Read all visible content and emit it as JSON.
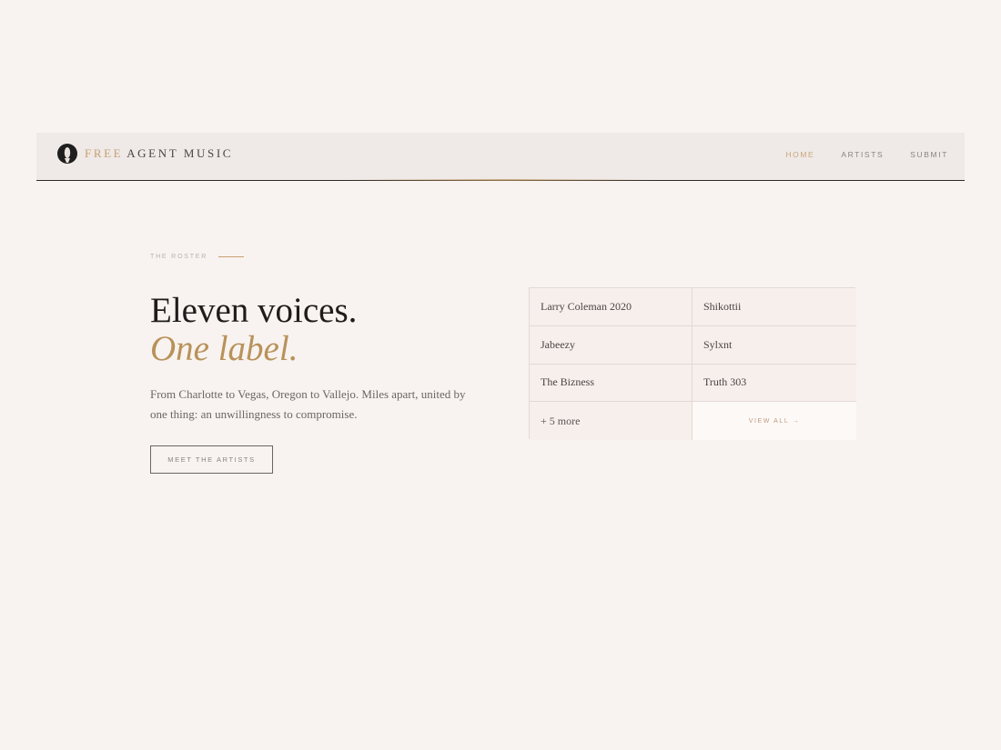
{
  "nav": {
    "brand_accent": "FREE",
    "brand_rest": "AGENT MUSIC",
    "links": [
      {
        "label": "HOME",
        "active": true
      },
      {
        "label": "ARTISTS",
        "active": false
      },
      {
        "label": "SUBMIT",
        "active": false
      }
    ]
  },
  "hero": {
    "eyebrow": "THE ROSTER",
    "title_line1": "Eleven voices.",
    "title_line2": "One label.",
    "description": "From Charlotte to Vegas, Oregon to Vallejo. Miles apart, united by one thing: an unwillingness to compromise.",
    "cta_label": "MEET THE ARTISTS"
  },
  "roster": {
    "artists": [
      "Larry Coleman 2020",
      "Shikottii",
      "Jabeezy",
      "Sylxnt",
      "The Bizness",
      "Truth 303"
    ],
    "more_label": "+ 5 more",
    "view_all_label": "VIEW ALL →"
  },
  "colors": {
    "background": "#f8f3f0",
    "accent": "#b8925a",
    "nav_bg": "#efe9e7",
    "text_dark": "#1f1c1b"
  }
}
